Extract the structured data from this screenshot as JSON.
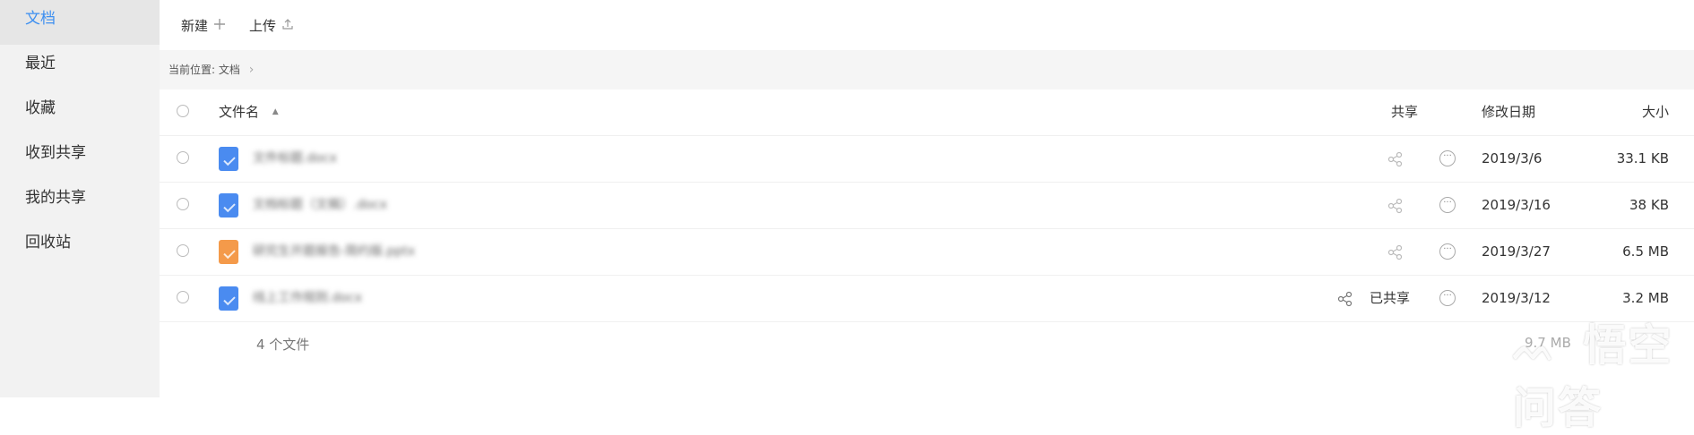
{
  "sidebar": {
    "items": [
      {
        "label": "文档",
        "active": true
      },
      {
        "label": "最近"
      },
      {
        "label": "收藏"
      },
      {
        "label": "收到共享"
      },
      {
        "label": "我的共享"
      },
      {
        "label": "回收站"
      }
    ]
  },
  "toolbar": {
    "new_label": "新建",
    "upload_label": "上传"
  },
  "breadcrumb": {
    "prefix": "当前位置:",
    "current": "文档"
  },
  "table": {
    "headers": {
      "name": "文件名",
      "share": "共享",
      "date": "修改日期",
      "size": "大小"
    },
    "rows": [
      {
        "name": "文件标题.docx",
        "type": "doc",
        "shared": false,
        "date": "2019/3/6",
        "size": "33.1 KB"
      },
      {
        "name": "文档标题（文稿）.docx",
        "type": "doc",
        "shared": false,
        "date": "2019/3/16",
        "size": "38 KB"
      },
      {
        "name": "研究生开题报告-简约版.pptx",
        "type": "pdf",
        "shared": false,
        "date": "2019/3/27",
        "size": "6.5 MB"
      },
      {
        "name": "线上工作规则.docx",
        "type": "doc",
        "shared": true,
        "shared_label": "已共享",
        "date": "2019/3/12",
        "size": "3.2 MB"
      }
    ]
  },
  "footer": {
    "count": "4 个文件",
    "total": "9.7 MB"
  },
  "watermark": {
    "text": "悟空问答"
  },
  "colors": {
    "accent": "#3d8ff0",
    "doc_icon": "#4a8bf0",
    "pdf_icon": "#f49a4a",
    "sidebar_bg": "#f2f2f2"
  }
}
